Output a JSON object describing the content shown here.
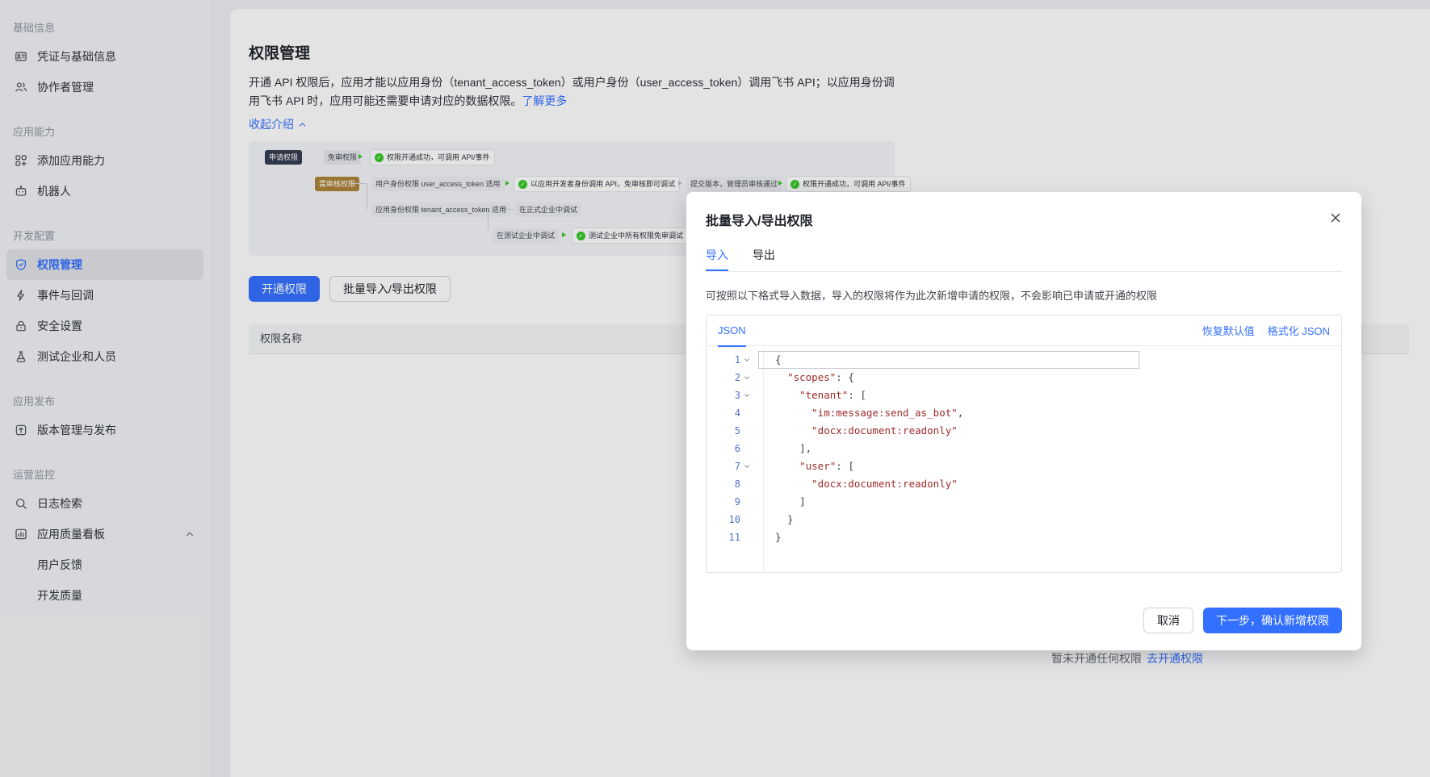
{
  "colors": {
    "accent": "#3370ff",
    "success": "#34c724"
  },
  "sidebar": {
    "sections": [
      {
        "title": "基础信息",
        "items": [
          {
            "key": "credentials",
            "icon": "id-card-icon",
            "label": "凭证与基础信息"
          },
          {
            "key": "collaborators",
            "icon": "people-icon",
            "label": "协作者管理"
          }
        ]
      },
      {
        "title": "应用能力",
        "items": [
          {
            "key": "add-capability",
            "icon": "grid-plus-icon",
            "label": "添加应用能力"
          },
          {
            "key": "bot",
            "icon": "robot-icon",
            "label": "机器人"
          }
        ]
      },
      {
        "title": "开发配置",
        "items": [
          {
            "key": "permission",
            "icon": "permission-icon",
            "label": "权限管理",
            "active": true
          },
          {
            "key": "events",
            "icon": "event-callback-icon",
            "label": "事件与回调"
          },
          {
            "key": "security",
            "icon": "security-icon",
            "label": "安全设置"
          },
          {
            "key": "test-org",
            "icon": "test-org-icon",
            "label": "测试企业和人员"
          }
        ]
      },
      {
        "title": "应用发布",
        "items": [
          {
            "key": "release",
            "icon": "release-icon",
            "label": "版本管理与发布"
          }
        ]
      },
      {
        "title": "运营监控",
        "items": [
          {
            "key": "logs",
            "icon": "log-search-icon",
            "label": "日志检索"
          },
          {
            "key": "quality-dashboard",
            "icon": "quality-dashboard-icon",
            "label": "应用质量看板",
            "expandable": true,
            "children": [
              {
                "key": "user-feedback",
                "label": "用户反馈"
              },
              {
                "key": "dev-quality",
                "label": "开发质量"
              }
            ]
          }
        ]
      }
    ]
  },
  "main": {
    "title": "权限管理",
    "description": "开通 API 权限后，应用才能以应用身份（tenant_access_token）或用户身份（user_access_token）调用飞书 API；以应用身份调用飞书 API 时，应用可能还需要申请对应的数据权限。",
    "learn_more": "了解更多",
    "collapse_intro": "收起介绍",
    "flow": {
      "apply": "申请权限",
      "free": "免审权限",
      "free_ok": "权限开通成功，可调用 API/事件",
      "review": "需审核权限",
      "user_scope": "用户身份权限 user_access_token 适用",
      "dev_debug": "以应用开发者身份调用 API，免审核即可调试",
      "submit": "提交版本，管理员审核通过",
      "review_ok": "权限开通成功，可调用 API/事件",
      "tenant_scope": "应用身份权限 tenant_access_token 适用",
      "formal_debug": "在正式企业中调试",
      "test_debug": "在测试企业中调试",
      "test_free": "测试企业中所有权限免审调试"
    },
    "open_permission_button": "开通权限",
    "batch_button": "批量导入/导出权限",
    "table_header": "权限名称",
    "empty_text": "暂未开通任何权限",
    "empty_link": "去开通权限"
  },
  "modal": {
    "title": "批量导入/导出权限",
    "tabs": {
      "import": "导入",
      "export": "导出"
    },
    "description": "可按照以下格式导入数据，导入的权限将作为此次新增申请的权限，不会影响已申请或开通的权限",
    "editor": {
      "lang_tab": "JSON",
      "restore_default": "恢复默认值",
      "format_json": "格式化 JSON",
      "lines": [
        {
          "num": "1",
          "fold": true,
          "active": true,
          "tokens": [
            {
              "t": "{",
              "c": "p"
            }
          ]
        },
        {
          "num": "2",
          "fold": true,
          "tokens": [
            {
              "t": "  ",
              "c": "p"
            },
            {
              "t": "\"scopes\"",
              "c": "s"
            },
            {
              "t": ": {",
              "c": "p"
            }
          ]
        },
        {
          "num": "3",
          "fold": true,
          "tokens": [
            {
              "t": "    ",
              "c": "p"
            },
            {
              "t": "\"tenant\"",
              "c": "s"
            },
            {
              "t": ": [",
              "c": "p"
            }
          ]
        },
        {
          "num": "4",
          "tokens": [
            {
              "t": "      ",
              "c": "p"
            },
            {
              "t": "\"im:message:send_as_bot\"",
              "c": "s"
            },
            {
              "t": ",",
              "c": "p"
            }
          ]
        },
        {
          "num": "5",
          "tokens": [
            {
              "t": "      ",
              "c": "p"
            },
            {
              "t": "\"docx:document:readonly\"",
              "c": "s"
            }
          ]
        },
        {
          "num": "6",
          "tokens": [
            {
              "t": "    ],",
              "c": "p"
            }
          ]
        },
        {
          "num": "7",
          "fold": true,
          "tokens": [
            {
              "t": "    ",
              "c": "p"
            },
            {
              "t": "\"user\"",
              "c": "s"
            },
            {
              "t": ": [",
              "c": "p"
            }
          ]
        },
        {
          "num": "8",
          "tokens": [
            {
              "t": "      ",
              "c": "p"
            },
            {
              "t": "\"docx:document:readonly\"",
              "c": "s"
            }
          ]
        },
        {
          "num": "9",
          "tokens": [
            {
              "t": "    ]",
              "c": "p"
            }
          ]
        },
        {
          "num": "10",
          "tokens": [
            {
              "t": "  }",
              "c": "p"
            }
          ]
        },
        {
          "num": "11",
          "tokens": [
            {
              "t": "}",
              "c": "p"
            }
          ]
        }
      ]
    },
    "cancel_button": "取消",
    "confirm_button": "下一步，确认新增权限"
  }
}
